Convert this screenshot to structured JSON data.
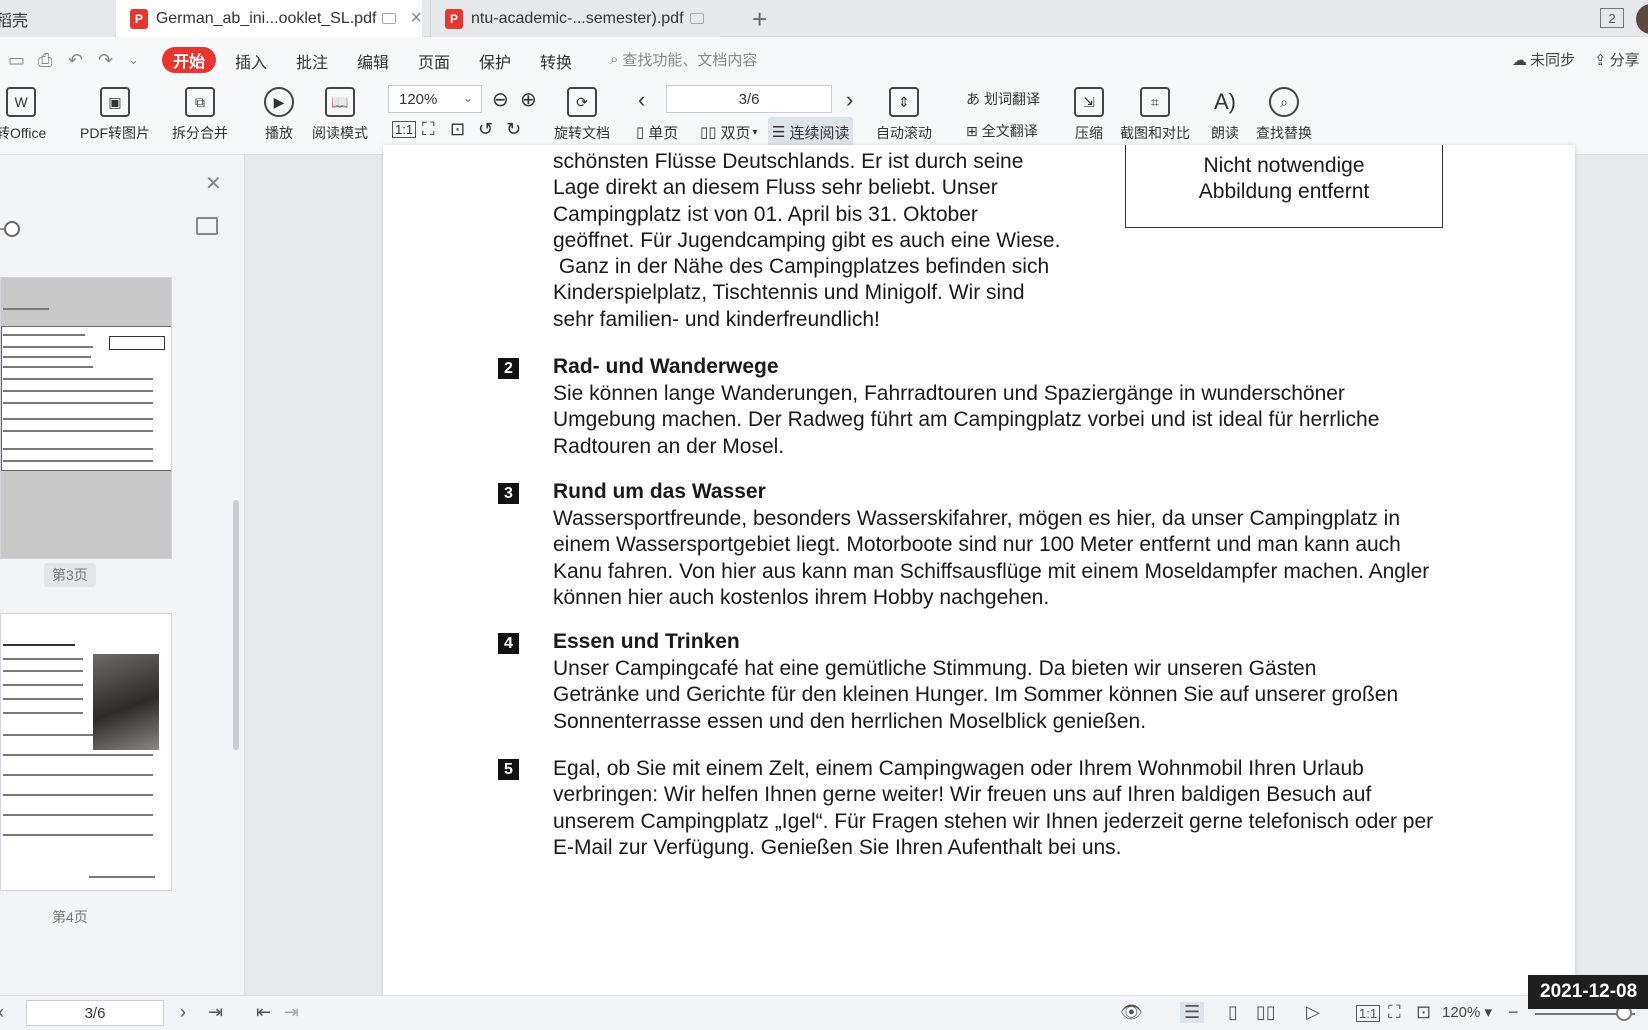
{
  "tabs": {
    "home_label": "稻壳",
    "active_label": "German_ab_ini...ooklet_SL.pdf",
    "inactive_label": "ntu-academic-...semester).pdf",
    "new_tab": "+",
    "window_count": "2"
  },
  "menu": {
    "items": [
      "开始",
      "插入",
      "批注",
      "编辑",
      "页面",
      "保护",
      "转换"
    ],
    "search_placeholder": "查找功能、文档内容",
    "sync_label": "未同步",
    "share_label": "分享"
  },
  "ribbon": {
    "to_office": "转Office",
    "pdf_to_image": "PDF转图片",
    "split_merge": "拆分合并",
    "play": "播放",
    "read_mode": "阅读模式",
    "zoom_value": "120%",
    "rotate_doc": "旋转文档",
    "page_value": "3/6",
    "single_page": "单页",
    "double_page": "双页",
    "continuous": "连续阅读",
    "auto_scroll": "自动滚动",
    "word_translate": "划词翻译",
    "full_translate": "全文翻译",
    "compress": "压缩",
    "screenshot_compare": "截图和对比",
    "read_aloud": "朗读",
    "find_replace": "查找替换"
  },
  "sidebar": {
    "page3_label": "第3页",
    "page4_label": "第4页"
  },
  "document": {
    "intro_lines": [
      "schönsten Flüsse Deutschlands. Er ist durch seine",
      "Lage direkt an diesem Fluss sehr beliebt. Unser",
      "Campingplatz ist von 01. April bis 31. Oktober",
      "geöffnet. Für Jugendcamping gibt es auch eine Wiese.",
      " Ganz in der Nähe des Campingplatzes befinden sich",
      "Kinderspielplatz, Tischtennis und Minigolf. Wir sind",
      "sehr familien- und kinderfreundlich!"
    ],
    "image_placeholder": "Nicht notwendige\nAbbildung entfernt",
    "sections": [
      {
        "num": "2",
        "heading": "Rad- und Wanderwege",
        "body": "Sie können lange Wanderungen, Fahrradtouren und Spaziergänge in wunderschöner\nUmgebung machen. Der Radweg führt am Campingplatz vorbei und ist ideal für herrliche\nRadtouren an der Mosel."
      },
      {
        "num": "3",
        "heading": "Rund um das Wasser",
        "body": "Wassersportfreunde, besonders Wasserskifahrer, mögen es hier, da unser Campingplatz in\neinem Wassersportgebiet liegt. Motorboote sind nur 100 Meter entfernt und man kann auch\nKanu fahren. Von hier aus kann man Schiffsausflüge mit einem Moseldampfer machen. Angler\nkönnen hier auch kostenlos ihrem Hobby nachgehen."
      },
      {
        "num": "4",
        "heading": "Essen und Trinken",
        "body": "Unser Campingcafé hat eine gemütliche Stimmung. Da bieten wir unseren Gästen\nGetränke und Gerichte für den kleinen Hunger. Im Sommer können Sie auf unserer großen\nSonnenterrasse essen und den herrlichen Moselblick genießen."
      },
      {
        "num": "5",
        "heading": "",
        "body": "Egal, ob Sie mit einem Zelt, einem Campingwagen oder Ihrem Wohnmobil Ihren Urlaub\nverbringen: Wir helfen Ihnen gerne weiter! Wir freuen uns auf Ihren baldigen Besuch auf\nunserem Campingplatz „Igel“. Für Fragen stehen wir Ihnen jederzeit gerne telefonisch oder per\nE-Mail zur Verfügung. Genießen Sie Ihren Aufenthalt bei uns."
      }
    ]
  },
  "statusbar": {
    "page_value": "3/6",
    "zoom_value": "120%"
  },
  "timestamp": "2021-12-08",
  "colors": {
    "accent": "#e5372f"
  }
}
